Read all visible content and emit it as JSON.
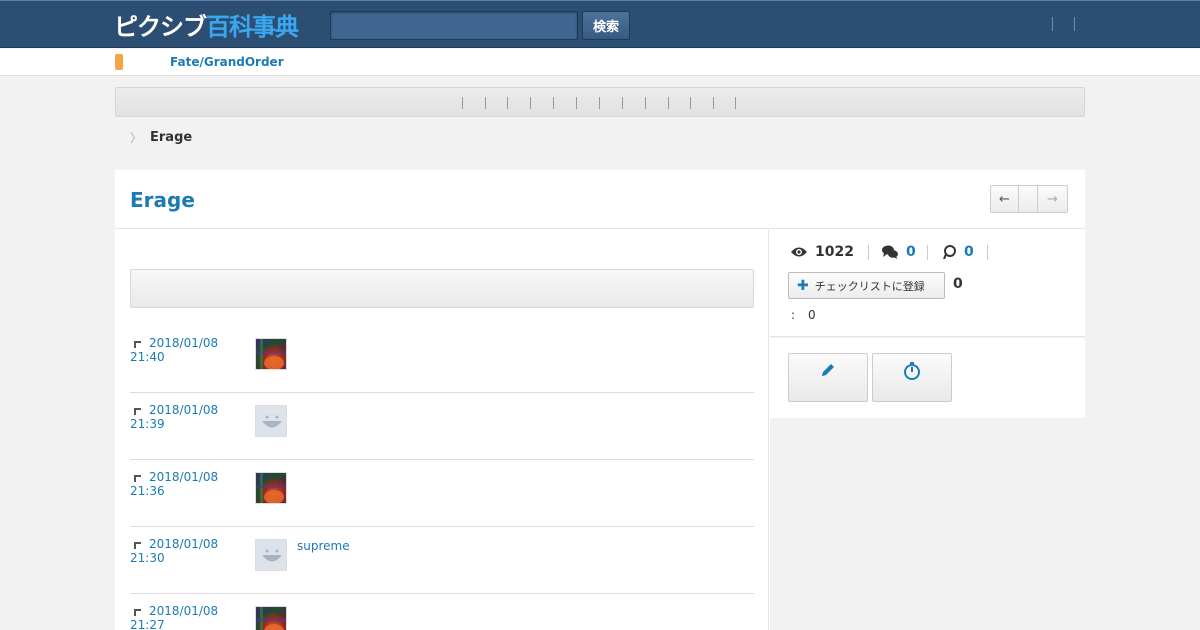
{
  "header": {
    "logo_part1": "ピクシブ",
    "logo_part2": "百科事典",
    "search_button": "検索",
    "search_placeholder": ""
  },
  "subnav": {
    "link": "Fate/GrandOrder"
  },
  "breadcrumb": {
    "arrow": "〉",
    "current": "Erage"
  },
  "article": {
    "title": "Erage",
    "prev": "←",
    "next": "→"
  },
  "history": [
    {
      "date": "2018/01/08",
      "time": "21:40",
      "avatar": "art",
      "user": ""
    },
    {
      "date": "2018/01/08",
      "time": "21:39",
      "avatar": "smile",
      "user": ""
    },
    {
      "date": "2018/01/08",
      "time": "21:36",
      "avatar": "art",
      "user": ""
    },
    {
      "date": "2018/01/08",
      "time": "21:30",
      "avatar": "smile",
      "user": "supreme"
    },
    {
      "date": "2018/01/08",
      "time": "21:27",
      "avatar": "art",
      "user": ""
    }
  ],
  "stats": {
    "views": "1022",
    "comments": "0",
    "pins": "0",
    "checklist_button": "チェックリストに登録",
    "checklist_count": "0",
    "colon": ":",
    "colon_value": "0"
  },
  "icons": {
    "views": "eye-icon",
    "comments": "speech-bubbles-icon",
    "pins": "pin-icon",
    "edit": "pencil-icon",
    "history": "stopwatch-icon"
  },
  "colors": {
    "header_bg": "#2d4e73",
    "accent": "#1b7bb5",
    "logo_blue": "#3aa7f0",
    "tag_orange": "#f5a44a"
  }
}
